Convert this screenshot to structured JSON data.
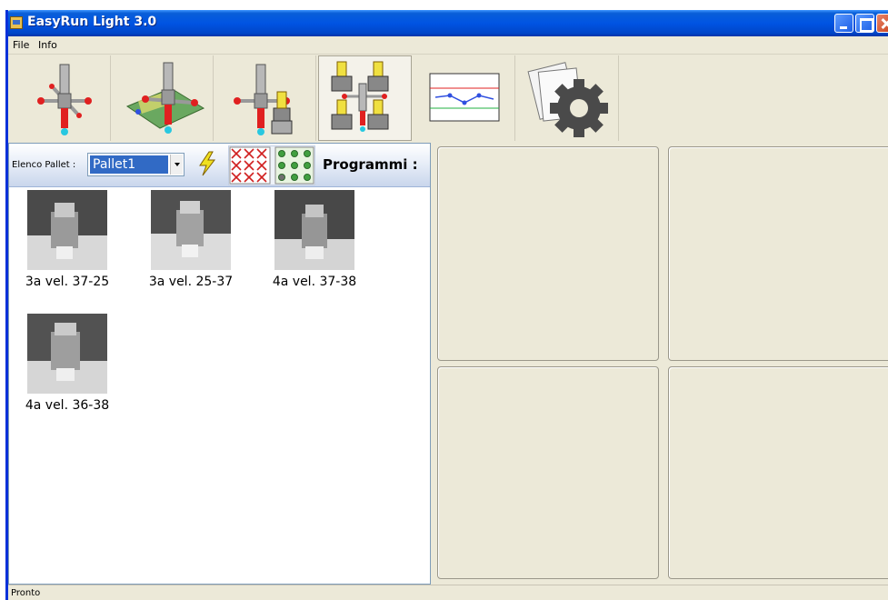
{
  "window": {
    "title": "EasyRun Light 3.0",
    "title_bar_color": "#0054e3"
  },
  "menu": {
    "file": "File",
    "info": "Info"
  },
  "toolbar": {
    "tools": [
      {
        "icon": "probe-cross-icon"
      },
      {
        "icon": "probe-on-plate-icon"
      },
      {
        "icon": "probe-with-part-icon"
      },
      {
        "icon": "multi-part-icon",
        "active": true
      },
      {
        "icon": "graph-icon"
      },
      {
        "icon": "settings-gear-icon"
      }
    ]
  },
  "pallet": {
    "label": "Elenco Pallet :",
    "selected": "Pallet1",
    "programs_label": "Programmi :",
    "highlight_color": "#316ac5"
  },
  "programs": [
    {
      "name": "3a vel. 37-25"
    },
    {
      "name": "3a vel. 25-37"
    },
    {
      "name": "4a vel. 37-38"
    },
    {
      "name": "4a vel. 36-38"
    }
  ],
  "status": {
    "text": "Pronto"
  }
}
